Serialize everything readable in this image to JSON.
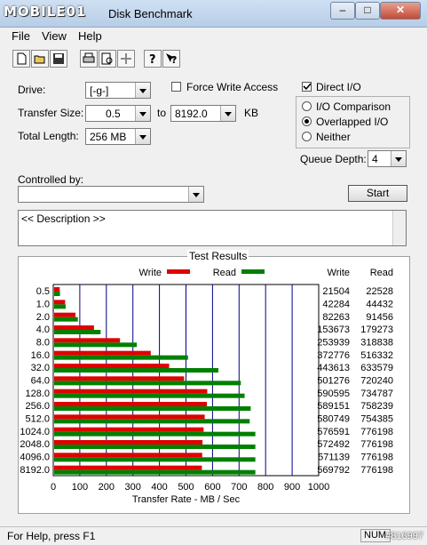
{
  "window": {
    "title": "Disk Benchmark",
    "logo": "MOBILE01"
  },
  "menu": [
    "File",
    "View",
    "Help"
  ],
  "toolbar": [
    "new-icon",
    "open-icon",
    "save-icon",
    "print-icon",
    "print-preview-icon",
    "move-icon",
    "help-icon",
    "context-help-icon"
  ],
  "form": {
    "drive_label": "Drive:",
    "drive_value": "[-g-]",
    "transfer_label": "Transfer Size:",
    "transfer_from": "0.5",
    "to_label": "to",
    "transfer_to": "8192.0",
    "unit": "KB",
    "length_label": "Total Length:",
    "length_value": "256 MB",
    "force_write": "Force Write Access",
    "force_write_checked": false,
    "direct_io": "Direct I/O",
    "direct_io_checked": true,
    "radios": [
      {
        "label": "I/O Comparison",
        "on": false
      },
      {
        "label": "Overlapped I/O",
        "on": true
      },
      {
        "label": "Neither",
        "on": false
      }
    ],
    "queue_label": "Queue Depth:",
    "queue_value": "4",
    "controlled_label": "Controlled by:",
    "controlled_value": "",
    "start": "Start",
    "description": "<< Description >>"
  },
  "results_title": "Test Results",
  "chart_data": {
    "type": "bar",
    "orientation": "horizontal",
    "categories": [
      "0.5",
      "1.0",
      "2.0",
      "4.0",
      "8.0",
      "16.0",
      "32.0",
      "64.0",
      "128.0",
      "256.0",
      "512.0",
      "1024.0",
      "2048.0",
      "4096.0",
      "8192.0"
    ],
    "series": [
      {
        "name": "Write",
        "color": "#e00000",
        "values": [
          21504,
          42284,
          82263,
          153673,
          253939,
          372776,
          443613,
          501276,
          590595,
          589151,
          580749,
          576591,
          572492,
          571139,
          569792
        ]
      },
      {
        "name": "Read",
        "color": "#008000",
        "values": [
          22528,
          44432,
          91456,
          179273,
          318838,
          516332,
          633579,
          720240,
          734787,
          758239,
          754385,
          776198,
          776198,
          776198,
          776198
        ]
      }
    ],
    "col_headers": [
      "Write",
      "Read"
    ],
    "xlabel": "Transfer Rate - MB / Sec",
    "xticks": [
      "0",
      "100",
      "200",
      "300",
      "400",
      "500",
      "600",
      "700",
      "800",
      "900",
      "1000"
    ],
    "xlim": [
      0,
      1000
    ],
    "legend": "top-center",
    "grid": true
  },
  "status": {
    "help": "For Help, press F1",
    "num": "NUM",
    "watermark": "#816997"
  }
}
